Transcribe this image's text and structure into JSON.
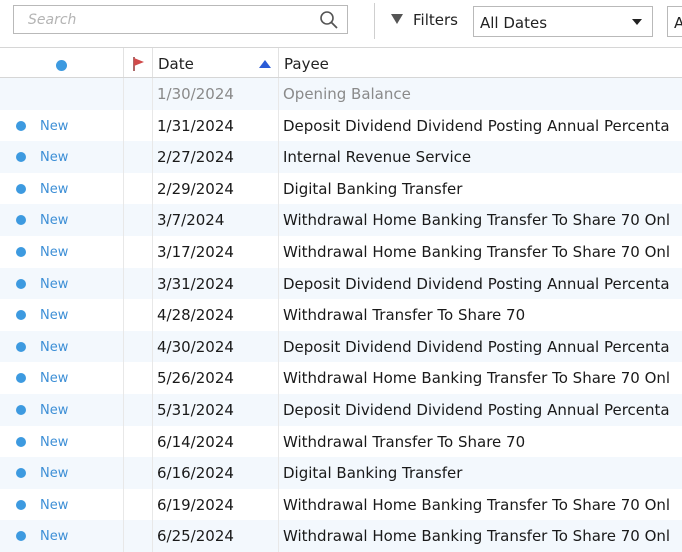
{
  "toolbar": {
    "search_placeholder": "Search",
    "filters_label": "Filters",
    "date_filter_value": "All Dates",
    "second_select_value": "A",
    "icons": [
      "search-icon",
      "filter-icon",
      "chevron-down-icon"
    ]
  },
  "columns": {
    "status": "",
    "flag": "",
    "date": "Date",
    "payee": "Payee",
    "sort": "date-ascending"
  },
  "colors": {
    "status_dot": "#3d9ae0",
    "status_text": "#3d8fd6",
    "flag": "#d04a4a",
    "sort_arrow": "#2a5bd7",
    "alt_row": "#f3f8fd"
  },
  "rows": [
    {
      "status": "",
      "date": "1/30/2024",
      "payee": "Opening Balance",
      "muted": true
    },
    {
      "status": "New",
      "date": "1/31/2024",
      "payee": "Deposit Dividend Dividend Posting Annual Percenta"
    },
    {
      "status": "New",
      "date": "2/27/2024",
      "payee": "Internal Revenue Service"
    },
    {
      "status": "New",
      "date": "2/29/2024",
      "payee": "Digital Banking Transfer"
    },
    {
      "status": "New",
      "date": "3/7/2024",
      "payee": "Withdrawal Home Banking Transfer To Share 70 Onl"
    },
    {
      "status": "New",
      "date": "3/17/2024",
      "payee": "Withdrawal Home Banking Transfer To Share 70 Onl"
    },
    {
      "status": "New",
      "date": "3/31/2024",
      "payee": "Deposit Dividend Dividend Posting Annual Percenta"
    },
    {
      "status": "New",
      "date": "4/28/2024",
      "payee": "Withdrawal Transfer To Share 70"
    },
    {
      "status": "New",
      "date": "4/30/2024",
      "payee": "Deposit Dividend Dividend Posting Annual Percenta"
    },
    {
      "status": "New",
      "date": "5/26/2024",
      "payee": "Withdrawal Home Banking Transfer To Share 70 Onl"
    },
    {
      "status": "New",
      "date": "5/31/2024",
      "payee": "Deposit Dividend Dividend Posting Annual Percenta"
    },
    {
      "status": "New",
      "date": "6/14/2024",
      "payee": "Withdrawal Transfer To Share 70"
    },
    {
      "status": "New",
      "date": "6/16/2024",
      "payee": "Digital Banking Transfer"
    },
    {
      "status": "New",
      "date": "6/19/2024",
      "payee": "Withdrawal Home Banking Transfer To Share 70 Onl"
    },
    {
      "status": "New",
      "date": "6/25/2024",
      "payee": "Withdrawal Home Banking Transfer To Share 70 Onl"
    }
  ]
}
